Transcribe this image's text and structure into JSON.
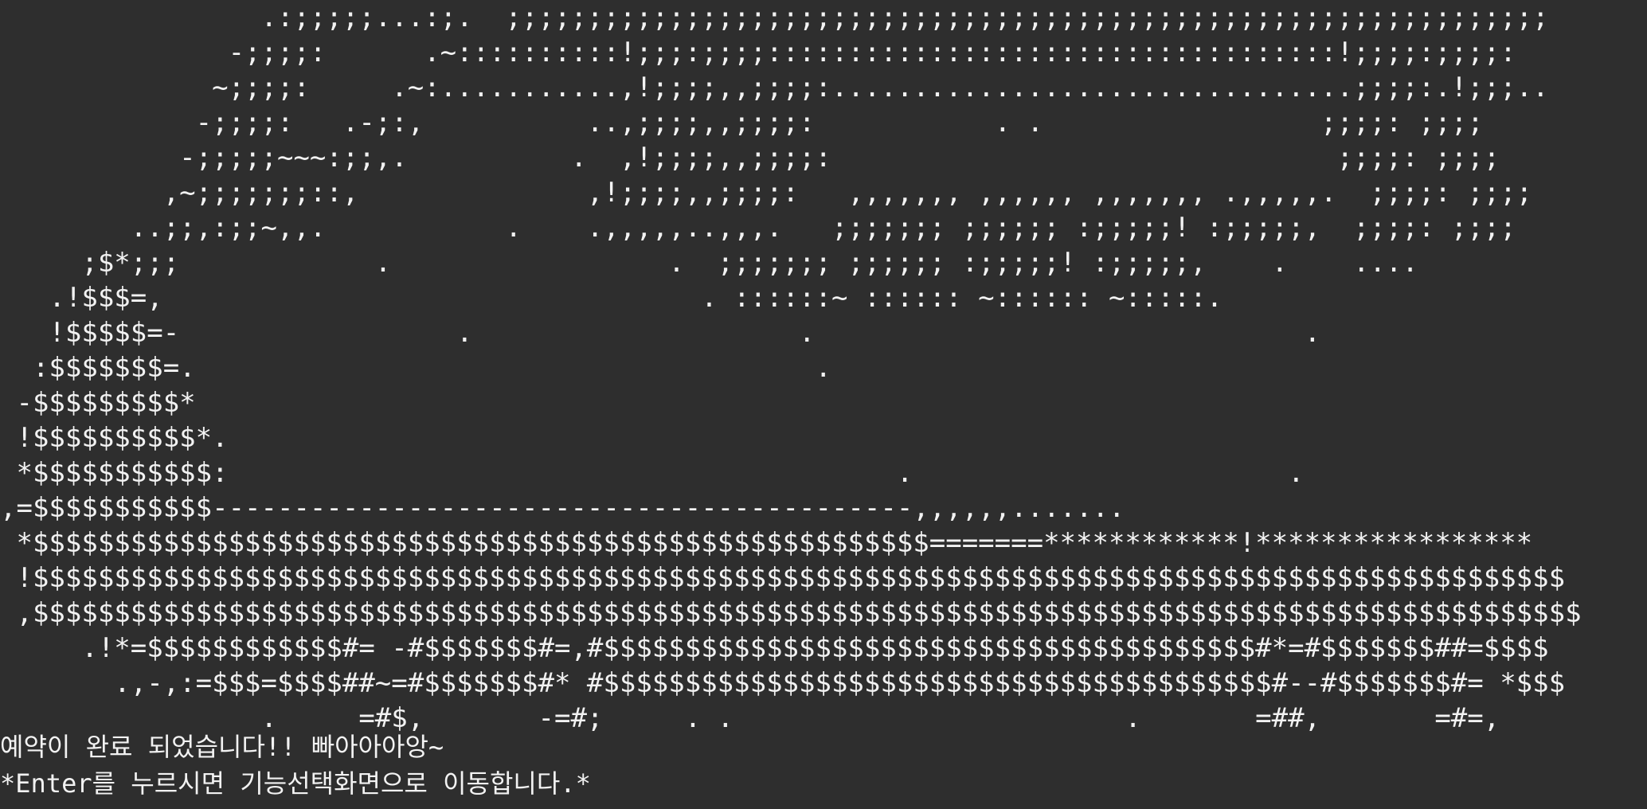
{
  "terminal": {
    "background": "#2e2e2e",
    "foreground": "#f2f2f2"
  },
  "ascii_art": [
    "                .:;;;;;...:;.  ;;;;;;;;;;;;;;;;;;;;;;;;;;;;;;;;;;;;;;;;;;;;;;;;;;;;;;;;;;;;;;;;",
    "              -;;;;:      .~::::::::::!;;;:;;;;:::::::::::::::::::::::::::::::::::!;;;;:;;;;:",
    "             ~;;;;:     .~:...........,!;;;;,,;;;;:................................;;;;:.!;;;..",
    "            -;;;;:   .-;:,          ..,;;;;,,;;;;:           . .                 ;;;;: ;;;;",
    "           -;;;;;~~~:;;,.          .  ,!;;;;,,;;;;:                               ;;;;: ;;;;",
    "          ,~;;;;;;;::,              ,!;;;;,,;;;;:   ,,,,,,, ,,,,,, ,,,,,,, .,,,,,.  ;;;;: ;;;;",
    "        ..;;,:;;~,,.           .    .,,,,,..,,,.   ;;;;;;; ;;;;;; :;;;;;! :;;;;;,  ;;;;: ;;;;",
    "     ;$*;;;            .                 .  ;;;;;;; ;;;;;; :;;;;;! :;;;;;,    .    ....",
    "   .!$$$=,                                 . ::::::~ :::::: ~:::::: ~:::::.",
    "   !$$$$$=-                 .                    .                              .",
    "  :$$$$$$$=.                                      .",
    " -$$$$$$$$$*",
    " !$$$$$$$$$$*.",
    " *$$$$$$$$$$$:                                         .                       .",
    ",=$$$$$$$$$$$-------------------------------------------,,,,,,.......",
    " *$$$$$$$$$$$$$$$$$$$$$$$$$$$$$$$$$$$$$$$$$$$$$$$$$$$$$$$=======************!*****************",
    " !$$$$$$$$$$$$$$$$$$$$$$$$$$$$$$$$$$$$$$$$$$$$$$$$$$$$$$$$$$$$$$$$$$$$$$$$$$$$$$$$$$$$$$$$$$$$$$",
    " ,$$$$$$$$$$$$$$$$$$$$$$$$$$$$$$$$$$$$$$$$$$$$$$$$$$$$$$$$$$$$$$$$$$$$$$$$$$$$$$$$$$$$$$$$$$$$$$$",
    "     .!*=$$$$$$$$$$$$#= -#$$$$$$$#=,#$$$$$$$$$$$$$$$$$$$$$$$$$$$$$$$$$$$$$$$$#*=#$$$$$$$##=$$$$",
    "       .,-,:=$$$=$$$$##~=#$$$$$$$#* #$$$$$$$$$$$$$$$$$$$$$$$$$$$$$$$$$$$$$$$$$#--#$$$$$$$#= *$$$",
    "                .     =#$,       -=#;     . .                        .       =##,       =#=,"
  ],
  "messages": {
    "line1": "예약이 완료 되었습니다!! 빠아아아앙~",
    "line2": "*Enter를 누르시면 기능선택화면으로 이동합니다.*"
  }
}
